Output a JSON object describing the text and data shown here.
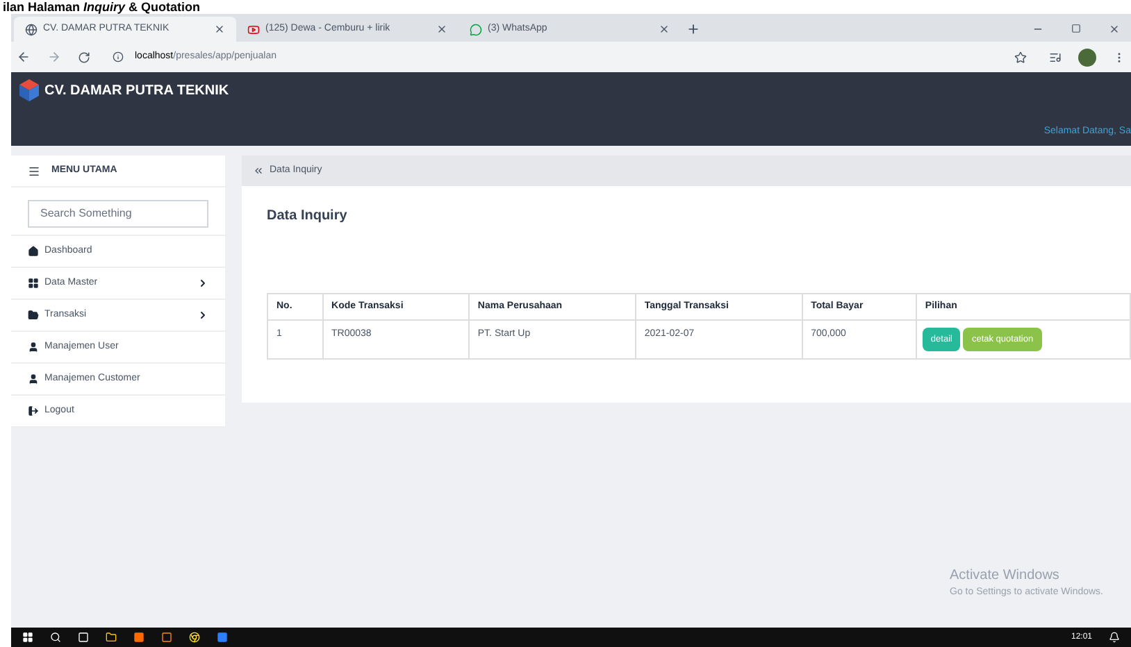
{
  "doc_heading": "ilan Halaman *Inquiry* & Quotation",
  "browser": {
    "tabs": [
      {
        "title": "CV. DAMAR PUTRA TEKNIK",
        "selected": true,
        "kind": "globe"
      },
      {
        "title": "(125) Dewa - Cemburu + lirik",
        "selected": false,
        "kind": "video"
      },
      {
        "title": "(3) WhatsApp",
        "selected": false,
        "kind": "chat"
      }
    ],
    "url_host": "localhost",
    "url_path": "/presales/app/penjualan"
  },
  "app": {
    "brand": "CV. DAMAR PUTRA TEKNIK",
    "welcome": "Selamat Datang, Sa"
  },
  "sidebar": {
    "title": "MENU UTAMA",
    "search_placeholder": "Search Something",
    "items": [
      {
        "label": "Dashboard",
        "has_submenu": false
      },
      {
        "label": "Data Master",
        "has_submenu": true
      },
      {
        "label": "Transaksi",
        "has_submenu": true
      },
      {
        "label": "Manajemen User",
        "has_submenu": false
      },
      {
        "label": "Manajemen Customer",
        "has_submenu": false
      },
      {
        "label": "Logout",
        "has_submenu": false
      }
    ]
  },
  "breadcrumb": "Data Inquiry",
  "page_title": "Data Inquiry",
  "table": {
    "columns": [
      "No.",
      "Kode Transaksi",
      "Nama Perusahaan",
      "Tanggal Transaksi",
      "Total Bayar",
      "Pilihan"
    ],
    "rows": [
      {
        "cells": [
          "1",
          "TR00038",
          "PT. Start Up",
          "2021-02-07",
          "700,000"
        ],
        "actions": [
          {
            "label": "detail",
            "kind": "teal"
          },
          {
            "label": "cetak quotation",
            "kind": "green"
          }
        ]
      }
    ]
  },
  "activation": {
    "title": "Activate Windows",
    "subtitle": "Go to Settings to activate Windows."
  },
  "taskbar": {
    "time": "12:01"
  }
}
